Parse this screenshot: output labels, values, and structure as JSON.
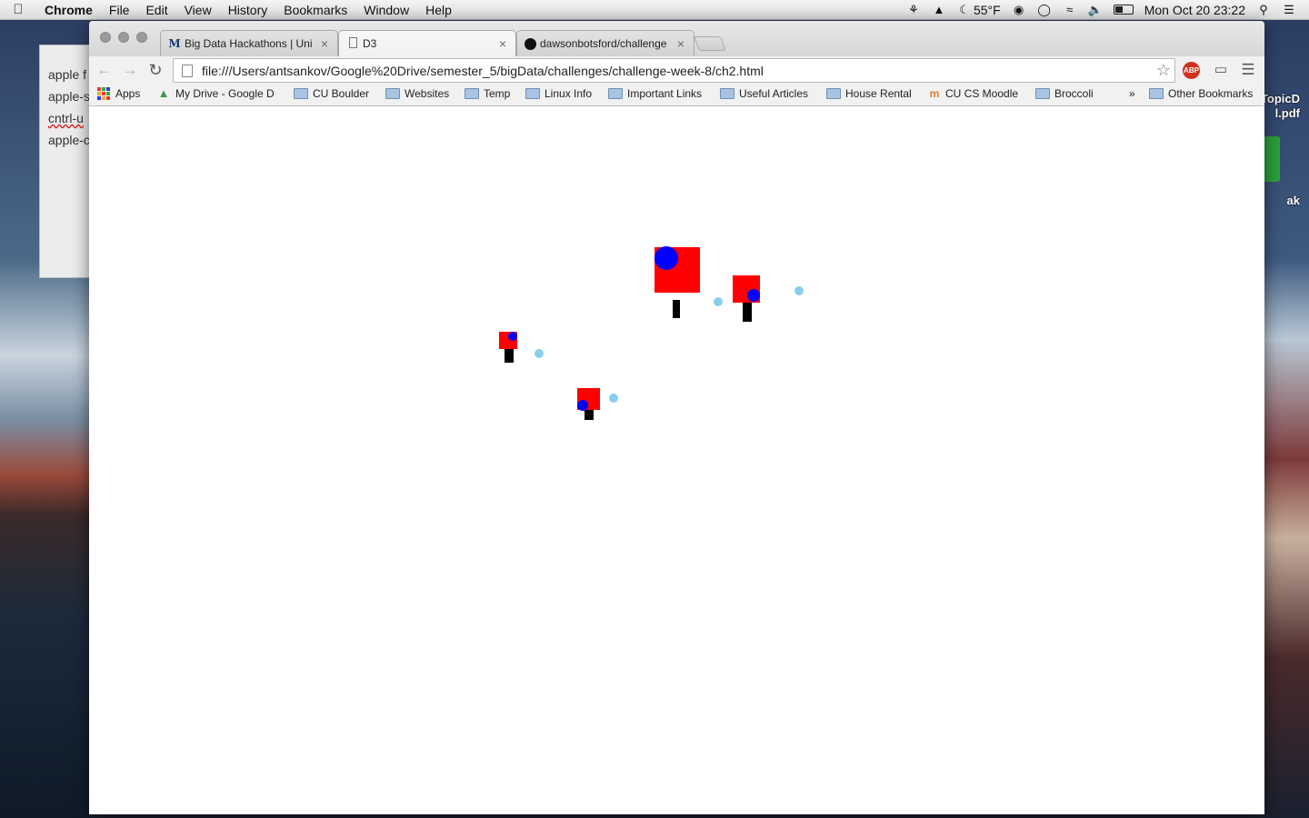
{
  "menubar": {
    "app_name": "Chrome",
    "menus": [
      "File",
      "Edit",
      "View",
      "History",
      "Bookmarks",
      "Window",
      "Help"
    ],
    "temperature": "55°F",
    "datetime": "Mon Oct 20  23:22"
  },
  "background_window": {
    "lines": [
      "apple f",
      "apple-s",
      "cntrl-u",
      "apple-c"
    ]
  },
  "desktop": {
    "file_label_1": "TopicD",
    "file_label_2": "l.pdf",
    "label_3": "ak"
  },
  "browser": {
    "tabs": [
      {
        "title": "Big Data Hackathons | Uni",
        "icon": "medium-m-icon"
      },
      {
        "title": "D3",
        "icon": "page-icon"
      },
      {
        "title": "dawsonbotsford/challenge",
        "icon": "github-icon"
      }
    ],
    "active_tab": 1,
    "url": "file:///Users/antsankov/Google%20Drive/semester_5/bigData/challenges/challenge-week-8/ch2.html",
    "abp_label": "ABP",
    "bookmarks": [
      {
        "label": "Apps",
        "icon": "apps-grid-icon"
      },
      {
        "label": "My Drive - Google D",
        "icon": "google-drive-icon"
      },
      {
        "label": "CU Boulder",
        "icon": "folder-icon"
      },
      {
        "label": "Websites",
        "icon": "folder-icon"
      },
      {
        "label": "Temp",
        "icon": "folder-icon"
      },
      {
        "label": "Linux Info",
        "icon": "folder-icon"
      },
      {
        "label": "Important Links",
        "icon": "folder-icon"
      },
      {
        "label": "Useful Articles",
        "icon": "folder-icon"
      },
      {
        "label": "House Rental",
        "icon": "folder-icon"
      },
      {
        "label": "CU CS Moodle",
        "icon": "moodle-icon"
      },
      {
        "label": "Broccoli",
        "icon": "folder-icon"
      }
    ],
    "overflow_label": "»",
    "other_bookmarks": "Other Bookmarks"
  },
  "colors": {
    "square": "#ff0000",
    "dot": "#0000ff",
    "stem": "#000000",
    "light_dot": "#87ceeb"
  }
}
